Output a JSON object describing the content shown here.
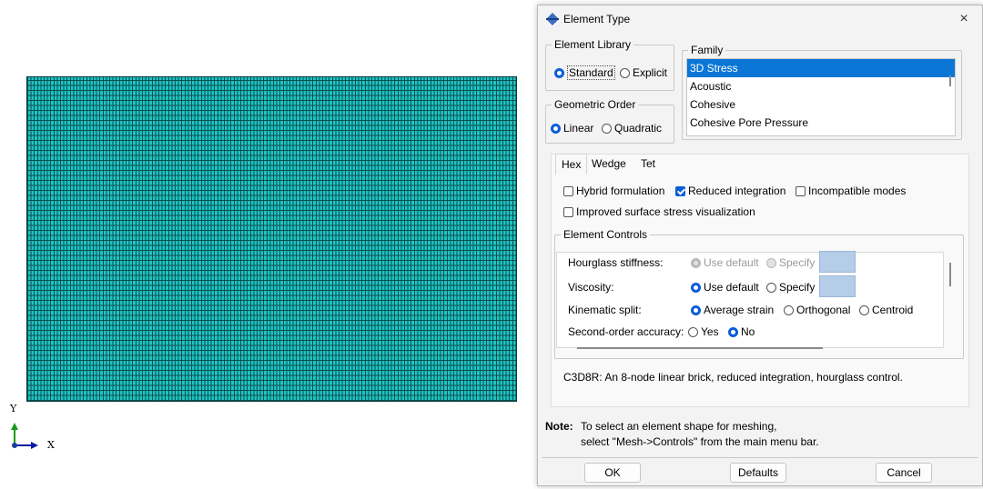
{
  "viewport": {
    "axis_y": "Y",
    "axis_x": "X",
    "mesh_color": "#1fc4c4"
  },
  "dialog": {
    "title": "Element Type",
    "close": "×",
    "element_library": {
      "label": "Element Library",
      "options": [
        "Standard",
        "Explicit"
      ],
      "selected": "Standard"
    },
    "geometric_order": {
      "label": "Geometric Order",
      "options": [
        "Linear",
        "Quadratic"
      ],
      "selected": "Linear"
    },
    "family": {
      "label": "Family",
      "items": [
        "3D Stress",
        "Acoustic",
        "Cohesive",
        "Cohesive Pore Pressure"
      ],
      "selected": "3D Stress"
    },
    "tabs": [
      "Hex",
      "Wedge",
      "Tet"
    ],
    "active_tab": "Hex",
    "checkboxes": {
      "hybrid": "Hybrid formulation",
      "reduced": "Reduced integration",
      "incompatible": "Incompatible modes",
      "improved": "Improved surface stress visualization"
    },
    "checkbox_states": {
      "hybrid": false,
      "reduced": true,
      "incompatible": false,
      "improved": false
    },
    "element_controls": {
      "label": "Element Controls",
      "hourglass_label": "Hourglass stiffness:",
      "hourglass_options": [
        "Use default",
        "Specify"
      ],
      "viscosity_label": "Viscosity:",
      "viscosity_options": [
        "Use default",
        "Specify"
      ],
      "kinematic_label": "Kinematic split:",
      "kinematic_options": [
        "Average strain",
        "Orthogonal",
        "Centroid"
      ],
      "second_order_label": "Second-order accuracy:",
      "second_order_options": [
        "Yes",
        "No"
      ]
    },
    "description": "C3D8R:  An 8-node linear brick, reduced integration, hourglass control.",
    "note_label": "Note:",
    "note_line1": "To select an element shape for meshing,",
    "note_line2": "select \"Mesh->Controls\" from the main menu bar.",
    "buttons": {
      "ok": "OK",
      "defaults": "Defaults",
      "cancel": "Cancel"
    },
    "accent_color": "#0b5ed7"
  }
}
